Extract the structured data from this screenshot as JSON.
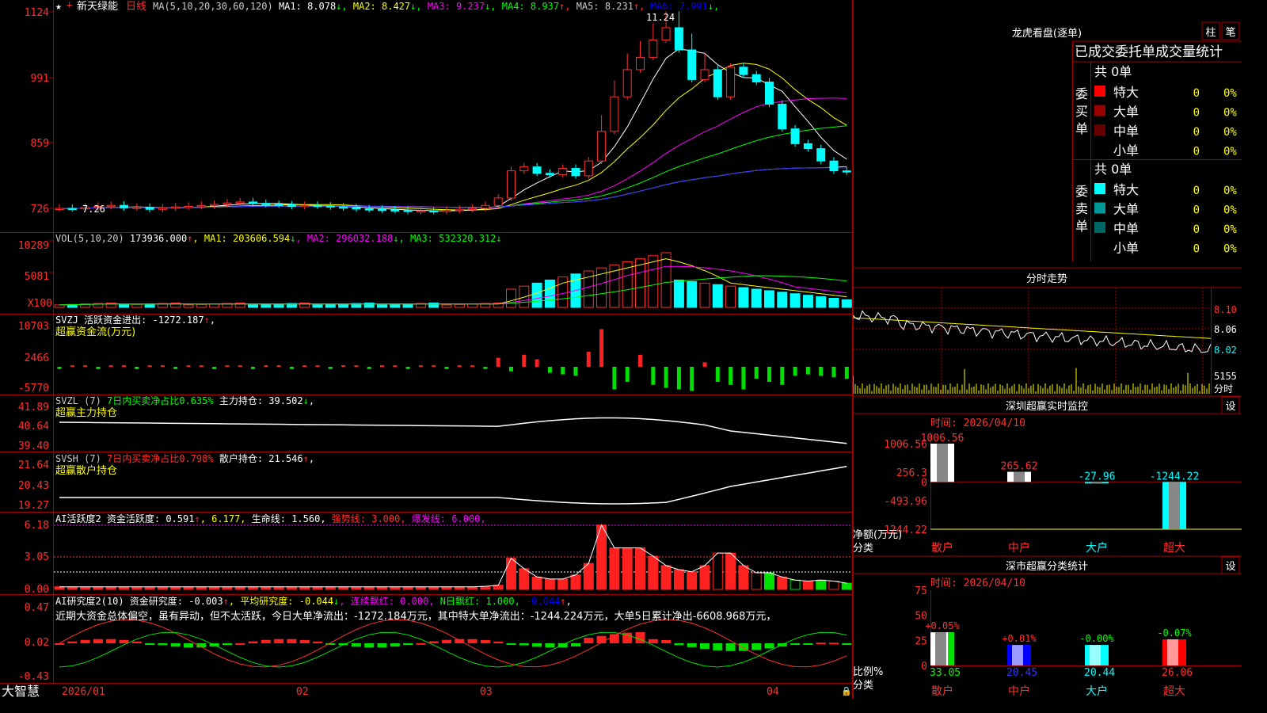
{
  "title_bar": {
    "stock_name": "新天绿能",
    "period": "日线",
    "ma_label": "MA(5,10,20,30,60,120)",
    "ma_values": [
      {
        "label": "MA1: 8.078",
        "arrow": "↓",
        "color": "#ffffff"
      },
      {
        "label": "MA2: 8.427",
        "arrow": "↓",
        "color": "#ffff00"
      },
      {
        "label": "MA3: 9.237",
        "arrow": "↓",
        "color": "#ff00ff"
      },
      {
        "label": "MA4: 8.937",
        "arrow": "↑",
        "color": "#00ff00"
      },
      {
        "label": "MA5: 8.231",
        "arrow": "↑",
        "color": "#cccccc"
      },
      {
        "label": "MA6: 7.991",
        "arrow": "↓",
        "color": "#0000ff"
      }
    ]
  },
  "panels": {
    "price": {
      "ticks": [
        "1124",
        "991",
        "859",
        "726"
      ],
      "high_label": "11.24",
      "low_label": "7.26"
    },
    "volume": {
      "ticks": [
        "10289",
        "5081",
        "X100"
      ],
      "header": [
        {
          "text": "VOL(5,10,20)",
          "color": "#cccccc"
        },
        {
          "text": " 173936.000",
          "color": "#ffffff"
        },
        {
          "text": "↑",
          "color": "#ff3030"
        },
        {
          "text": ", MA1: ",
          "color": "#ffff00"
        },
        {
          "text": "203606.594",
          "color": "#ffff00"
        },
        {
          "text": "↓",
          "color": "#00ff00"
        },
        {
          "text": ", MA2: 296032.188",
          "color": "#ff00ff"
        },
        {
          "text": "↓",
          "color": "#00ff00"
        },
        {
          "text": ", MA3: 532320.312",
          "color": "#00ff00"
        },
        {
          "text": "↓",
          "color": "#00ff00"
        }
      ]
    },
    "svzj": {
      "ticks": [
        "10703",
        "2466",
        "-5770"
      ],
      "header": [
        {
          "text": "SVZJ  活跃资金进出: -1272.187",
          "color": "#ffffff"
        },
        {
          "text": "↑",
          "color": "#ff3030"
        },
        {
          "text": ",",
          "color": "#ffffff"
        }
      ],
      "sub": "超赢资金流(万元)"
    },
    "svzl": {
      "ticks": [
        "41.89",
        "40.64",
        "39.40"
      ],
      "header": [
        {
          "text": "SVZL (7) ",
          "color": "#cccccc"
        },
        {
          "text": "7日内买卖净占比0.635%",
          "color": "#00ff00"
        },
        {
          "text": " 主力持仓: 39.502",
          "color": "#ffffff"
        },
        {
          "text": "↓",
          "color": "#00ff00"
        },
        {
          "text": ",",
          "color": "#ffffff"
        }
      ],
      "sub": "超赢主力持仓"
    },
    "svsh": {
      "ticks": [
        "21.64",
        "20.43",
        "19.27"
      ],
      "header": [
        {
          "text": "SVSH (7) ",
          "color": "#cccccc"
        },
        {
          "text": "7日内买卖净占比0.798%",
          "color": "#ff3030"
        },
        {
          "text": " 散户持仓: 21.546",
          "color": "#ffffff"
        },
        {
          "text": "↑",
          "color": "#ff3030"
        },
        {
          "text": ",",
          "color": "#ffffff"
        }
      ],
      "sub": "超赢散户持仓"
    },
    "ai_active": {
      "ticks": [
        "6.18",
        "3.05",
        "0.00"
      ],
      "header": [
        {
          "text": "AI活跃度2 资金活跃度: 0.591",
          "color": "#ffffff"
        },
        {
          "text": "↑",
          "color": "#ff3030"
        },
        {
          "text": ", 6.177,",
          "color": "#ffff00"
        },
        {
          "text": " 生命线: 1.560,",
          "color": "#ffffff"
        },
        {
          "text": " 强势线: 3.000,",
          "color": "#ff3030"
        },
        {
          "text": " 爆发线: 6.000,",
          "color": "#ff00ff"
        }
      ]
    },
    "ai_research": {
      "ticks": [
        "0.47",
        "0.02",
        "-0.43"
      ],
      "header": [
        {
          "text": "AI研究度2(10) 资金研究度: -0.003",
          "color": "#ffffff"
        },
        {
          "text": "↑",
          "color": "#ff3030"
        },
        {
          "text": ", 平均研究度: -0.044",
          "color": "#ffff00"
        },
        {
          "text": "↓",
          "color": "#00ff00"
        },
        {
          "text": ", 连续飘红: 0.000,",
          "color": "#ff00ff"
        },
        {
          "text": " N日飘红: 1.000,",
          "color": "#00ff00"
        },
        {
          "text": " -0.044",
          "color": "#0000ff"
        },
        {
          "text": "↑",
          "color": "#ff3030"
        },
        {
          "text": ",",
          "color": "#ffffff"
        }
      ],
      "note": "近期大资金总体偏空，虽有异动，但不太活跃，今日大单净流出：-1272.184万元，其中特大单净流出：-1244.224万元，大单5日累计净出-6608.968万元，"
    }
  },
  "x_axis": {
    "labels": [
      "2026/01",
      "02",
      "03",
      "04"
    ]
  },
  "brand": "大智慧",
  "right_panel": {
    "longhu": {
      "title": "龙虎看盘(逐单)",
      "btn1": "柱",
      "btn2": "笔",
      "header": "已成交委托单成交量统计",
      "buy": {
        "label": "委买单",
        "total": "共 0单",
        "rows": [
          {
            "name": "特大",
            "vol": "0",
            "pct": "0%",
            "color": "#ff0000"
          },
          {
            "name": "大单",
            "vol": "0",
            "pct": "0%",
            "color": "#990000"
          },
          {
            "name": "中单",
            "vol": "0",
            "pct": "0%",
            "color": "#660000"
          },
          {
            "name": "小单",
            "vol": "0",
            "pct": "0%",
            "color": "#000000"
          }
        ]
      },
      "sell": {
        "label": "委卖单",
        "total": "共 0单",
        "rows": [
          {
            "name": "特大",
            "vol": "0",
            "pct": "0%",
            "color": "#00ffff"
          },
          {
            "name": "大单",
            "vol": "0",
            "pct": "0%",
            "color": "#009999"
          },
          {
            "name": "中单",
            "vol": "0",
            "pct": "0%",
            "color": "#006666"
          },
          {
            "name": "小单",
            "vol": "0",
            "pct": "0%",
            "color": "#000000"
          }
        ]
      }
    },
    "fenshi": {
      "title": "分时走势",
      "ticks": [
        "8.10",
        "8.06",
        "8.02"
      ],
      "vol_tick": "5155",
      "vol_unit": "分时"
    },
    "monitor": {
      "title": "深圳超赢实时监控",
      "set": "设",
      "time": "时间: 2026/04/10",
      "ticks": [
        "1006.56",
        "256.3",
        "0",
        "-493.96",
        "-1244.22"
      ],
      "ylabel": "净额(万元)",
      "xlabel": "分类"
    },
    "classify": {
      "title": "深市超赢分类统计",
      "set": "设",
      "time": "时间: 2026/04/10",
      "ticks": [
        "75",
        "50",
        "25",
        "0"
      ],
      "ylabel": "比例%",
      "xlabel": "分类"
    }
  },
  "chart_data": [
    {
      "type": "bar",
      "title": "深圳超赢实时监控",
      "ylabel": "净额(万元)",
      "categories": [
        "散户",
        "中户",
        "大户",
        "超大"
      ],
      "values": [
        1006.56,
        265.62,
        -27.96,
        -1244.22
      ],
      "value_labels": [
        "1006.56",
        "265.62",
        "-27.96",
        "-1244.22"
      ],
      "ylim": [
        -1244.22,
        1006.56
      ],
      "colors": [
        "#ffffff",
        "#ffffff",
        "#00ffff",
        "#00ffff"
      ]
    },
    {
      "type": "bar",
      "title": "深市超赢分类统计",
      "ylabel": "比例%",
      "categories": [
        "散户",
        "中户",
        "大户",
        "超大"
      ],
      "values": [
        33.05,
        20.45,
        20.44,
        26.06
      ],
      "change_labels": [
        "+0.05%",
        "+0.01%",
        "-0.00%",
        "-0.07%"
      ],
      "change_colors": [
        "#ff3030",
        "#ff3030",
        "#00ff00",
        "#00ff00"
      ],
      "bar_colors": [
        "#ffffff",
        "#0000ff",
        "#00ffff",
        "#ff0000"
      ],
      "label_colors": [
        "#00ff00",
        "#3333ff",
        "#00ffff",
        "#ff3030"
      ],
      "ylim": [
        0,
        75
      ]
    },
    {
      "type": "candlestick",
      "title": "新天绿能 日线",
      "x": [
        "2026/01",
        "02",
        "03",
        "04"
      ],
      "ylim": [
        7.26,
        11.24
      ],
      "high": 11.24,
      "low": 7.26,
      "last_close": 8.08
    }
  ]
}
